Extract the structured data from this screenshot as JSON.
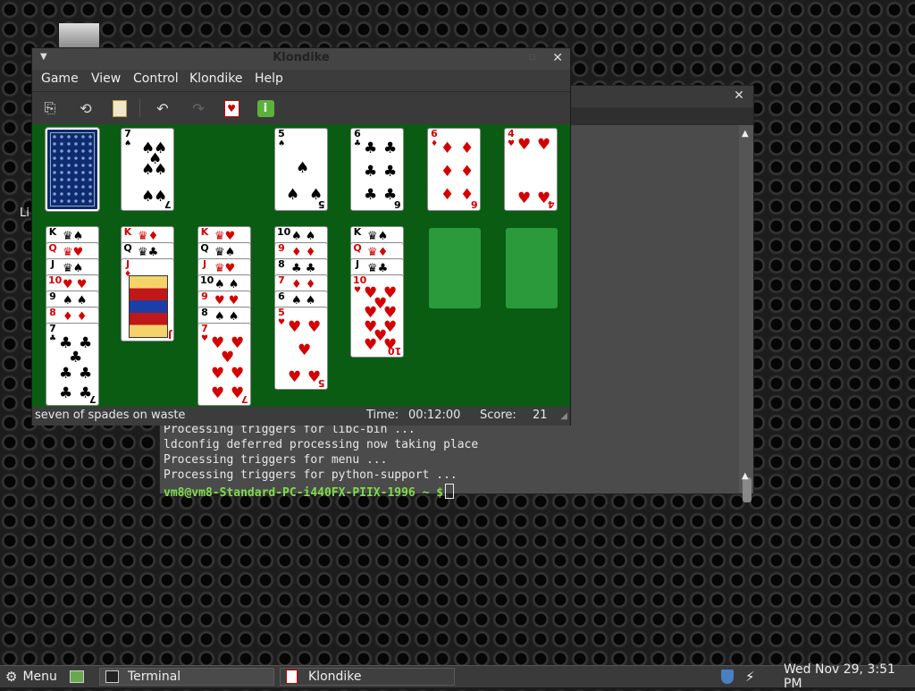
{
  "terminal": {
    "lines": [
      "Processing triggers for libc-bin ...",
      "ldconfig deferred processing now taking place",
      "Processing triggers for menu ...",
      "Processing triggers for python-support ..."
    ],
    "prompt": "vm8@vm8-Standard-PC-i440FX-PIIX-1996 ~ $"
  },
  "klondike": {
    "title": "Klondike",
    "menus": [
      "Game",
      "View",
      "Control",
      "Klondike",
      "Help"
    ],
    "toolbar": {
      "new_game": "new-game-icon",
      "restart": "restart-icon",
      "select": "select-game-icon",
      "undo": "undo-icon",
      "redo": "redo-icon",
      "hint": "hint-icon",
      "info": "info-icon"
    },
    "status": {
      "message": "seven of spades on waste",
      "time_label": "Time:",
      "time": "00:12:00",
      "score_label": "Score:",
      "score": "21"
    },
    "waste": {
      "rank": "7",
      "suit": "♠"
    },
    "foundations": [
      {
        "rank": "5",
        "suit": "♠"
      },
      {
        "rank": "6",
        "suit": "♣"
      },
      {
        "rank": "6",
        "suit": "♦"
      },
      {
        "rank": "4",
        "suit": "♥"
      }
    ],
    "tableau": [
      [
        "K♠",
        "Q♥",
        "J♠",
        "10♥",
        "9♠",
        "8♦",
        "7♣"
      ],
      [
        "K♦",
        "Q♣",
        "J♦"
      ],
      [
        "K♥",
        "Q♠",
        "J♥",
        "10♠",
        "9♥",
        "8♠",
        "7♥"
      ],
      [
        "10♠",
        "9♦",
        "8♣",
        "7♦",
        "6♠",
        "5♥"
      ],
      [
        "K♠",
        "Q♦",
        "J♣",
        "10♥"
      ]
    ]
  },
  "panel": {
    "menu_label": "Menu",
    "tasks": [
      "Terminal",
      "Klondike"
    ],
    "clock": "Wed Nov 29,  3:51 PM"
  },
  "desktop": {
    "partial_label": "Li"
  }
}
